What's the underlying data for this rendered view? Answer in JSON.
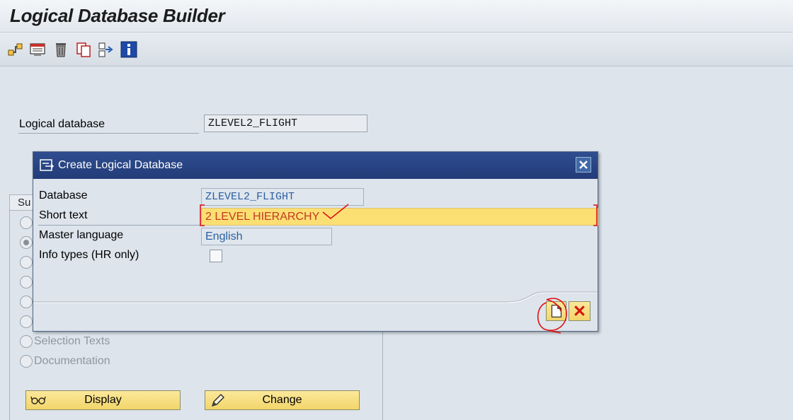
{
  "window": {
    "title": "Logical Database Builder"
  },
  "toolbar": {
    "buttons": [
      {
        "icon": "hierarchy-icon"
      },
      {
        "icon": "display-structure-icon"
      },
      {
        "icon": "delete-icon"
      },
      {
        "icon": "copy-icon"
      },
      {
        "icon": "move-icon"
      },
      {
        "icon": "info-icon"
      }
    ]
  },
  "main": {
    "logical_database_label": "Logical database",
    "logical_database_value": "ZLEVEL2_FLIGHT",
    "subobjects_tab": "Su",
    "radios": [
      {
        "label": "",
        "selected": false
      },
      {
        "label": "",
        "selected": true
      },
      {
        "label": "",
        "selected": false
      },
      {
        "label": "",
        "selected": false
      },
      {
        "label": "",
        "selected": false
      },
      {
        "label": "",
        "selected": false
      },
      {
        "label": "Selection Texts",
        "selected": false
      },
      {
        "label": "Documentation",
        "selected": false
      }
    ],
    "display_button": "Display",
    "change_button": "Change"
  },
  "dialog": {
    "title": "Create Logical Database",
    "fields": {
      "database_label": "Database",
      "database_value": "ZLEVEL2_FLIGHT",
      "short_text_label": "Short text",
      "short_text_value": "2 LEVEL HIERARCHY",
      "master_language_label": "Master language",
      "master_language_value": "English",
      "info_types_label": "Info types (HR only)",
      "info_types_checked": false
    }
  },
  "colors": {
    "dialog_title_bg": "#223c78",
    "required_field_bg": "#fbdf73",
    "button_yellow": "#f2d56a",
    "annotation_red": "#e01010"
  }
}
